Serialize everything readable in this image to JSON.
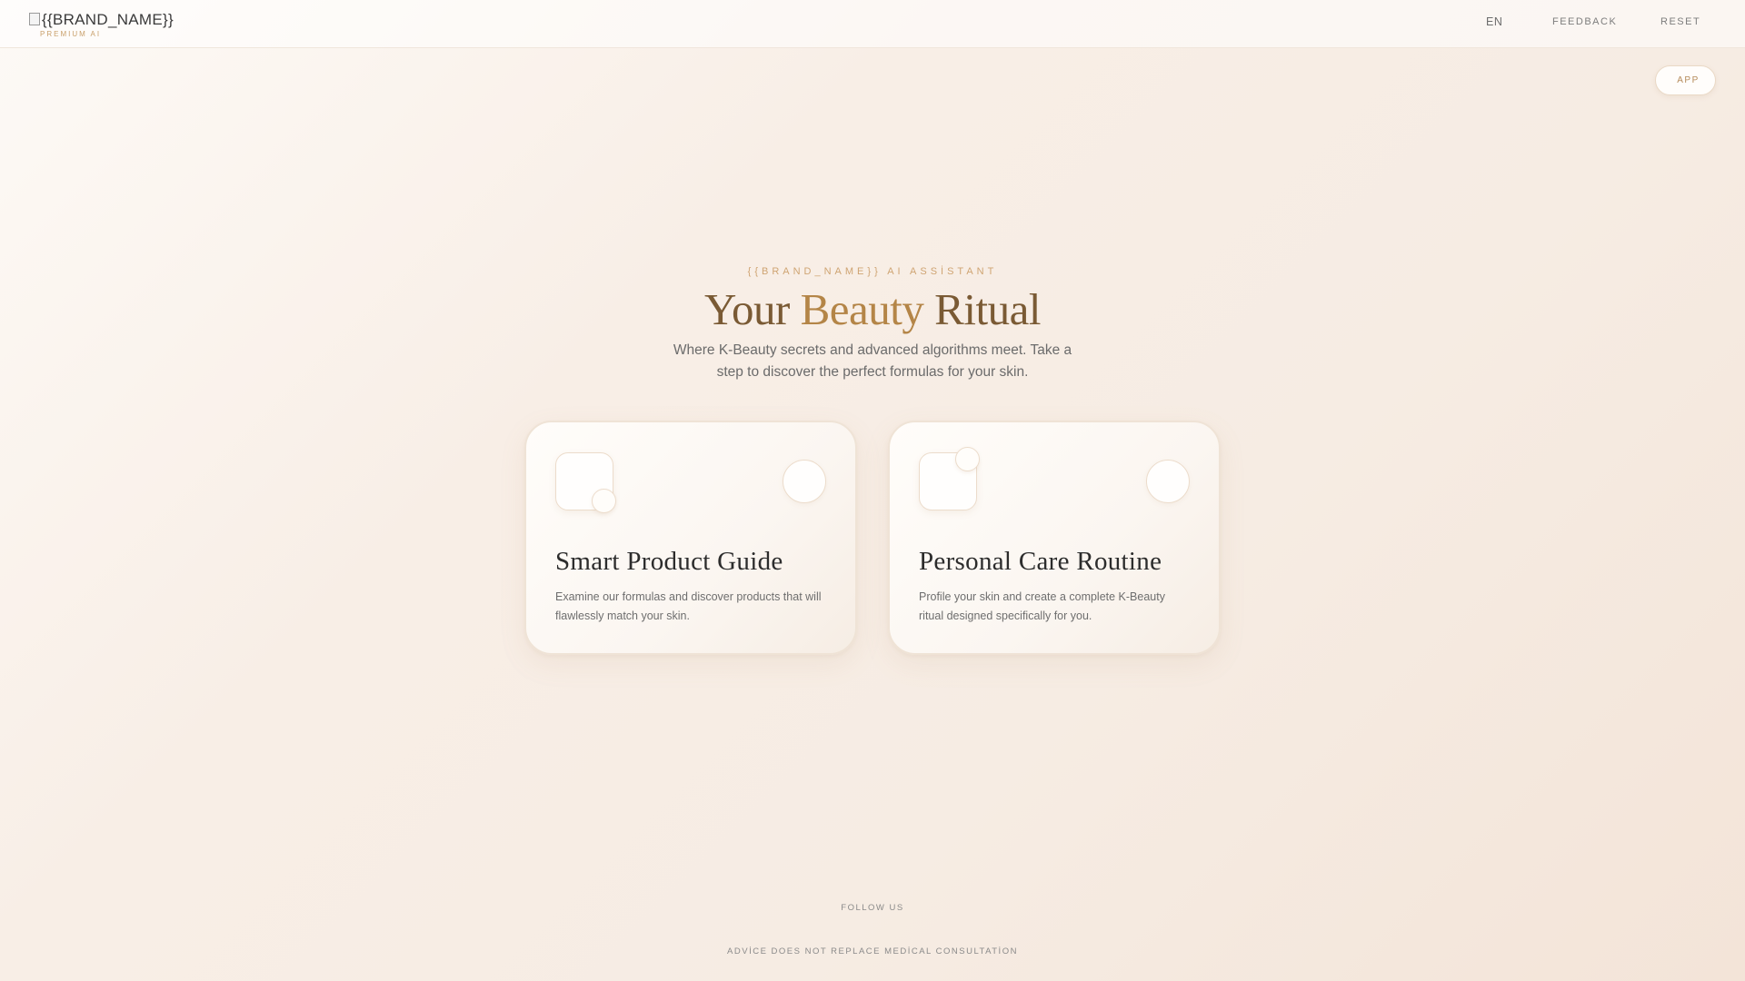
{
  "header": {
    "logo": {
      "text": "{{BRAND_NAME}}",
      "sub": "PREMIUM AI"
    },
    "theme_toggle_glyph": "",
    "language": {
      "value": "EN",
      "chevron": ""
    },
    "feedback": {
      "label": "FEEDBACK",
      "icon": ""
    },
    "reset": {
      "label": "RESET",
      "icon": ""
    }
  },
  "app_button": {
    "label": "APP",
    "icon": ""
  },
  "hero": {
    "eyebrow": "{{BRAND_NAME}} AI ASSİSTANT",
    "title_part1": "Your ",
    "title_accent": "Beauty",
    "title_part2": " Ritual",
    "subtitle": "Where K-Beauty secrets and advanced algorithms meet. Take a step to discover the perfect formulas for your skin."
  },
  "cards": [
    {
      "title": "Smart Product Guide",
      "description": "Examine our formulas and discover products that will flawlessly match your skin.",
      "icon": "",
      "badge": "",
      "arrow": ""
    },
    {
      "title": "Personal Care Routine",
      "description": "Profile your skin and create a complete K-Beauty ritual designed specifically for you.",
      "icon": "",
      "badge": "",
      "arrow": ""
    }
  ],
  "footer": {
    "follow": "FOLLOW US",
    "disclaimer": "ADVİCE DOES NOT REPLACE MEDİCAL CONSULTATİON"
  },
  "colors": {
    "accent": "#b48547",
    "title_dark": "#7a5a34",
    "eyebrow": "#cfa472",
    "background": "#f6ece3"
  }
}
